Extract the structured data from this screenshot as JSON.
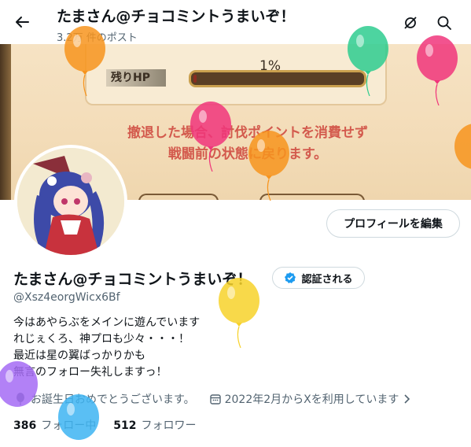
{
  "header": {
    "title": "たまさん@チョコミントうまいぞ！",
    "post_count": "3.2万 件のポスト"
  },
  "banner": {
    "hp_label": "残りHP",
    "hp_percent_text": "1%",
    "hp_fraction": 0.02,
    "message_line1": "撤退した場合、討伐ポイントを消費せず",
    "message_line2": "戦闘前の状態に戻ります。"
  },
  "profile": {
    "edit_label": "プロフィールを編集",
    "name": "たまさん@チョコミントうまいぞ！",
    "verify_label": "認証される",
    "handle": "@Xsz4eorgWicx6Bf",
    "bio": [
      "今はあやらぶをメインに遊んでいます",
      "れじぇくろ、神プロも少々・・・！",
      "最近は星の翼ばっかりかも",
      "無言のフォロー失礼しますっ！"
    ],
    "birthday": "お誕生日おめでとうございます。",
    "joined": "2022年2月からXを利用しています",
    "following_count": "386",
    "following_label": "フォロー中",
    "followers_count": "512",
    "followers_label": "フォロワー"
  },
  "colors": {
    "verified_blue": "#1d9bf0",
    "balloon_colors": [
      "#f7941d",
      "#2ecc8f",
      "#f0357b",
      "#f7d22a",
      "#a46bf4",
      "#3db4f2"
    ]
  },
  "icons": [
    "back-arrow-icon",
    "mute-icon",
    "search-icon",
    "verified-badge-icon",
    "balloon-icon",
    "calendar-icon",
    "chevron-right-icon"
  ]
}
